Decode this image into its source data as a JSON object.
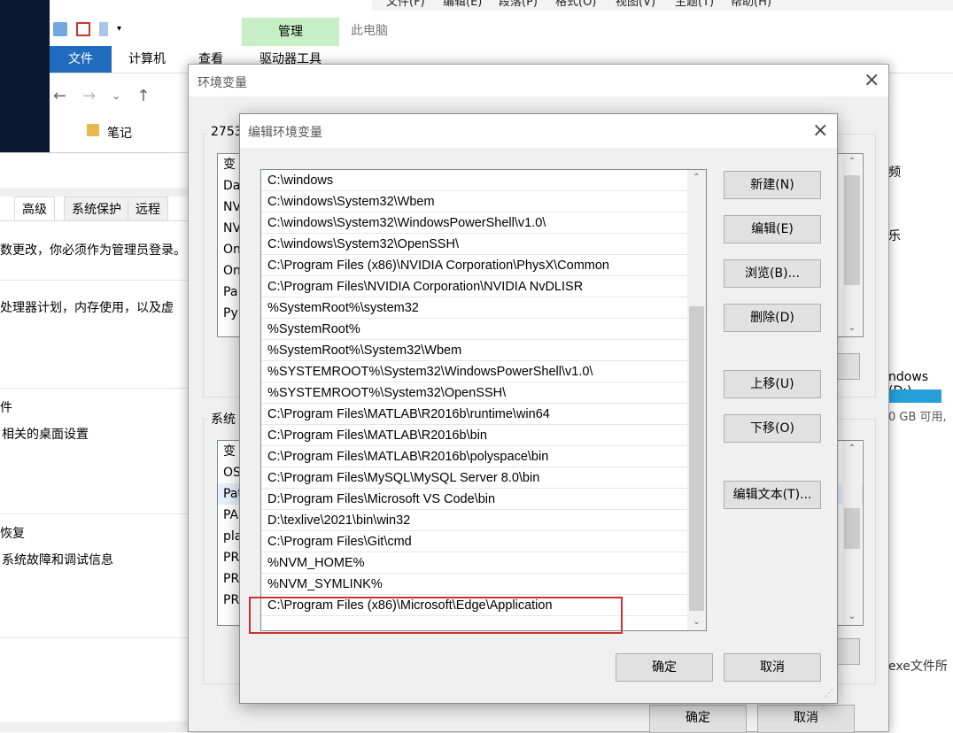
{
  "word_menu": [
    "文件(F)",
    "编辑(E)",
    "段落(P)",
    "格式(O)",
    "视图(V)",
    "主题(T)",
    "帮助(H)"
  ],
  "explorer": {
    "tabs": {
      "file": "文件",
      "computer": "计算机",
      "view": "查看",
      "manage": "管理",
      "drive_tools": "驱动器工具"
    },
    "title": "此电脑",
    "folder": "笔记"
  },
  "system_props": {
    "tabs": {
      "advanced": "高级",
      "protection": "系统保护",
      "remote": "远程"
    },
    "admin_note": "数更改，你必须作为管理员登录。",
    "perf_desc": "处理器计划，内存使用，以及虚",
    "profile_title": "件",
    "profile_desc": "相关的桌面设置",
    "startup_title": "恢复",
    "startup_desc": "系统故障和调试信息"
  },
  "right_panel": {
    "frag1": "频",
    "frag2": "乐",
    "drive": "ndows (D:)",
    "free": "0 GB 可用,",
    "exe": "exe文件所"
  },
  "env_dialog": {
    "title": "环境变量",
    "user_group": "2753",
    "user_col": "变",
    "user_vars": [
      "Da",
      "NV",
      "NV",
      "On",
      "On",
      "Pa",
      "Py"
    ],
    "sys_group": "系统",
    "sys_col": "变",
    "sys_vars": [
      "OS",
      "Pat",
      "PA",
      "pla",
      "PR",
      "PR",
      "PR"
    ],
    "ok": "确定",
    "cancel": "取消"
  },
  "edit_dialog": {
    "title": "编辑环境变量",
    "paths": [
      "C:\\windows",
      "C:\\windows\\System32\\Wbem",
      "C:\\windows\\System32\\WindowsPowerShell\\v1.0\\",
      "C:\\windows\\System32\\OpenSSH\\",
      "C:\\Program Files (x86)\\NVIDIA Corporation\\PhysX\\Common",
      "C:\\Program Files\\NVIDIA Corporation\\NVIDIA NvDLISR",
      "%SystemRoot%\\system32",
      "%SystemRoot%",
      "%SystemRoot%\\System32\\Wbem",
      "%SYSTEMROOT%\\System32\\WindowsPowerShell\\v1.0\\",
      "%SYSTEMROOT%\\System32\\OpenSSH\\",
      "C:\\Program Files\\MATLAB\\R2016b\\runtime\\win64",
      "C:\\Program Files\\MATLAB\\R2016b\\bin",
      "C:\\Program Files\\MATLAB\\R2016b\\polyspace\\bin",
      "C:\\Program Files\\MySQL\\MySQL Server 8.0\\bin",
      "D:\\Program Files\\Microsoft VS Code\\bin",
      "D:\\texlive\\2021\\bin\\win32",
      "C:\\Program Files\\Git\\cmd",
      "%NVM_HOME%",
      "%NVM_SYMLINK%",
      "C:\\Program Files (x86)\\Microsoft\\Edge\\Application"
    ],
    "buttons": {
      "new": "新建(N)",
      "edit": "编辑(E)",
      "browse": "浏览(B)...",
      "delete": "删除(D)",
      "up": "上移(U)",
      "down": "下移(O)",
      "edit_text": "编辑文本(T)...",
      "ok": "确定",
      "cancel": "取消"
    },
    "highlight_color": "#d32f2f"
  }
}
